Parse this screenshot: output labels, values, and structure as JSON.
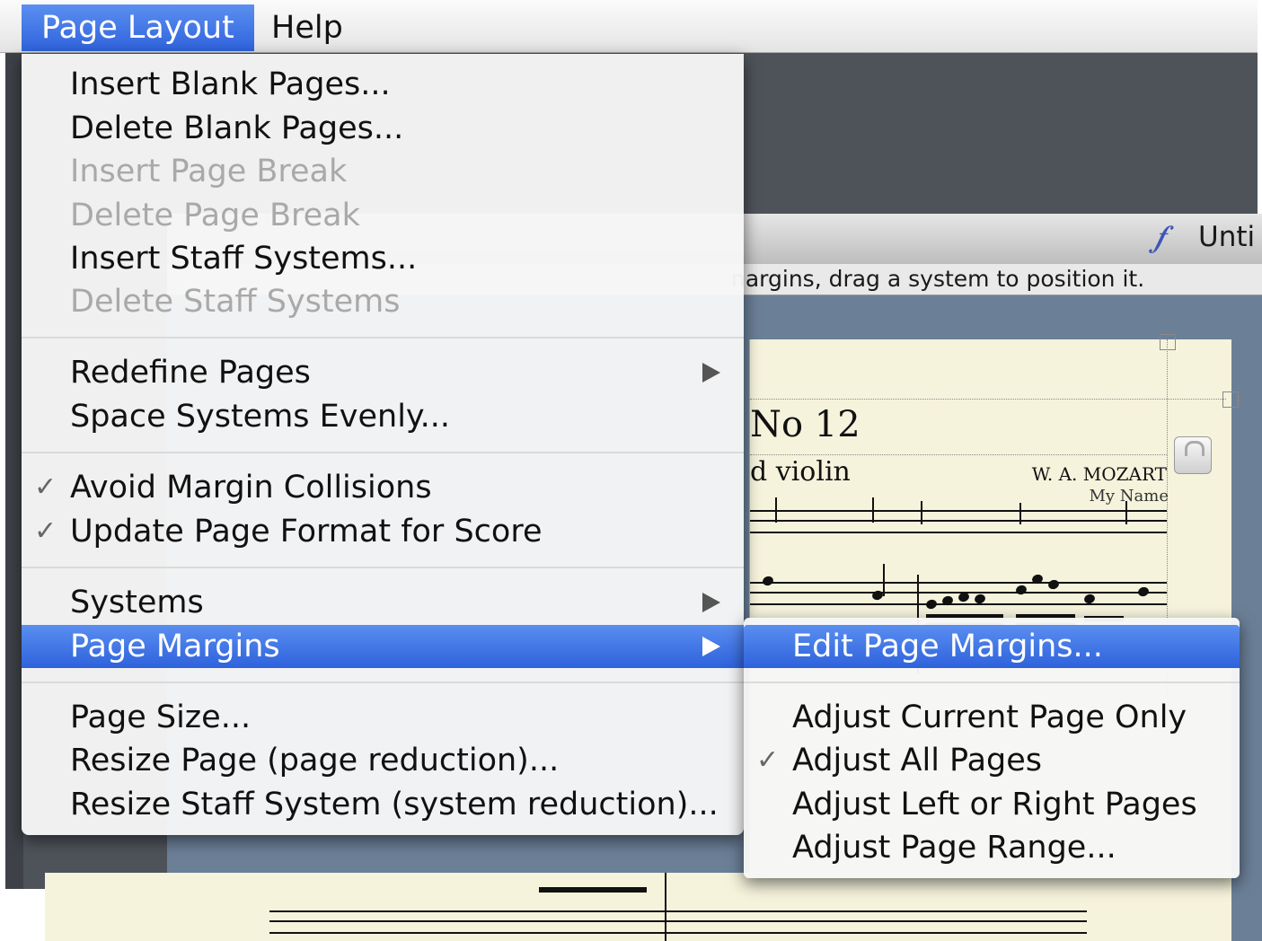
{
  "menubar": {
    "items": [
      {
        "label": "Page Layout",
        "active": true
      },
      {
        "label": "Help",
        "active": false
      }
    ]
  },
  "page_layout_menu": {
    "groups": [
      [
        {
          "label": "Insert Blank Pages...",
          "enabled": true
        },
        {
          "label": "Delete Blank Pages...",
          "enabled": true
        },
        {
          "label": "Insert Page Break",
          "enabled": false
        },
        {
          "label": "Delete Page Break",
          "enabled": false
        },
        {
          "label": "Insert Staff Systems...",
          "enabled": true
        },
        {
          "label": "Delete Staff Systems",
          "enabled": false
        }
      ],
      [
        {
          "label": "Redefine Pages",
          "enabled": true,
          "submenu": true
        },
        {
          "label": "Space Systems Evenly...",
          "enabled": true
        }
      ],
      [
        {
          "label": "Avoid Margin Collisions",
          "enabled": true,
          "checked": true
        },
        {
          "label": "Update Page Format for Score",
          "enabled": true,
          "checked": true
        }
      ],
      [
        {
          "label": "Systems",
          "enabled": true,
          "submenu": true
        },
        {
          "label": "Page Margins",
          "enabled": true,
          "submenu": true,
          "highlighted": true
        }
      ],
      [
        {
          "label": "Page Size...",
          "enabled": true
        },
        {
          "label": "Resize Page (page reduction)...",
          "enabled": true
        },
        {
          "label": "Resize Staff System (system reduction)...",
          "enabled": true
        }
      ]
    ]
  },
  "page_margins_submenu": {
    "items": [
      {
        "label": "Edit Page Margins...",
        "highlighted": true
      },
      {
        "label": "Adjust Current Page Only",
        "checked": false
      },
      {
        "label": "Adjust All Pages",
        "checked": true
      },
      {
        "label": "Adjust Left or Right Pages",
        "checked": false
      },
      {
        "label": "Adjust Page Range...",
        "checked": false
      }
    ]
  },
  "document_window": {
    "title": "Unti",
    "hint": "nargins, drag a system to position it."
  },
  "score": {
    "title": "No 12",
    "subtitle": "d violin",
    "composer": "W. A. MOZART",
    "arranger": "My Name"
  },
  "icons": {
    "check": "✓",
    "app_icon": "finale-icon",
    "lock": "lock-icon"
  },
  "colors": {
    "highlight": "#2f63dd",
    "menu_bg": "#f6f6f6",
    "disabled_text": "#a9a9a9",
    "score_paper": "#f6f3dc"
  }
}
